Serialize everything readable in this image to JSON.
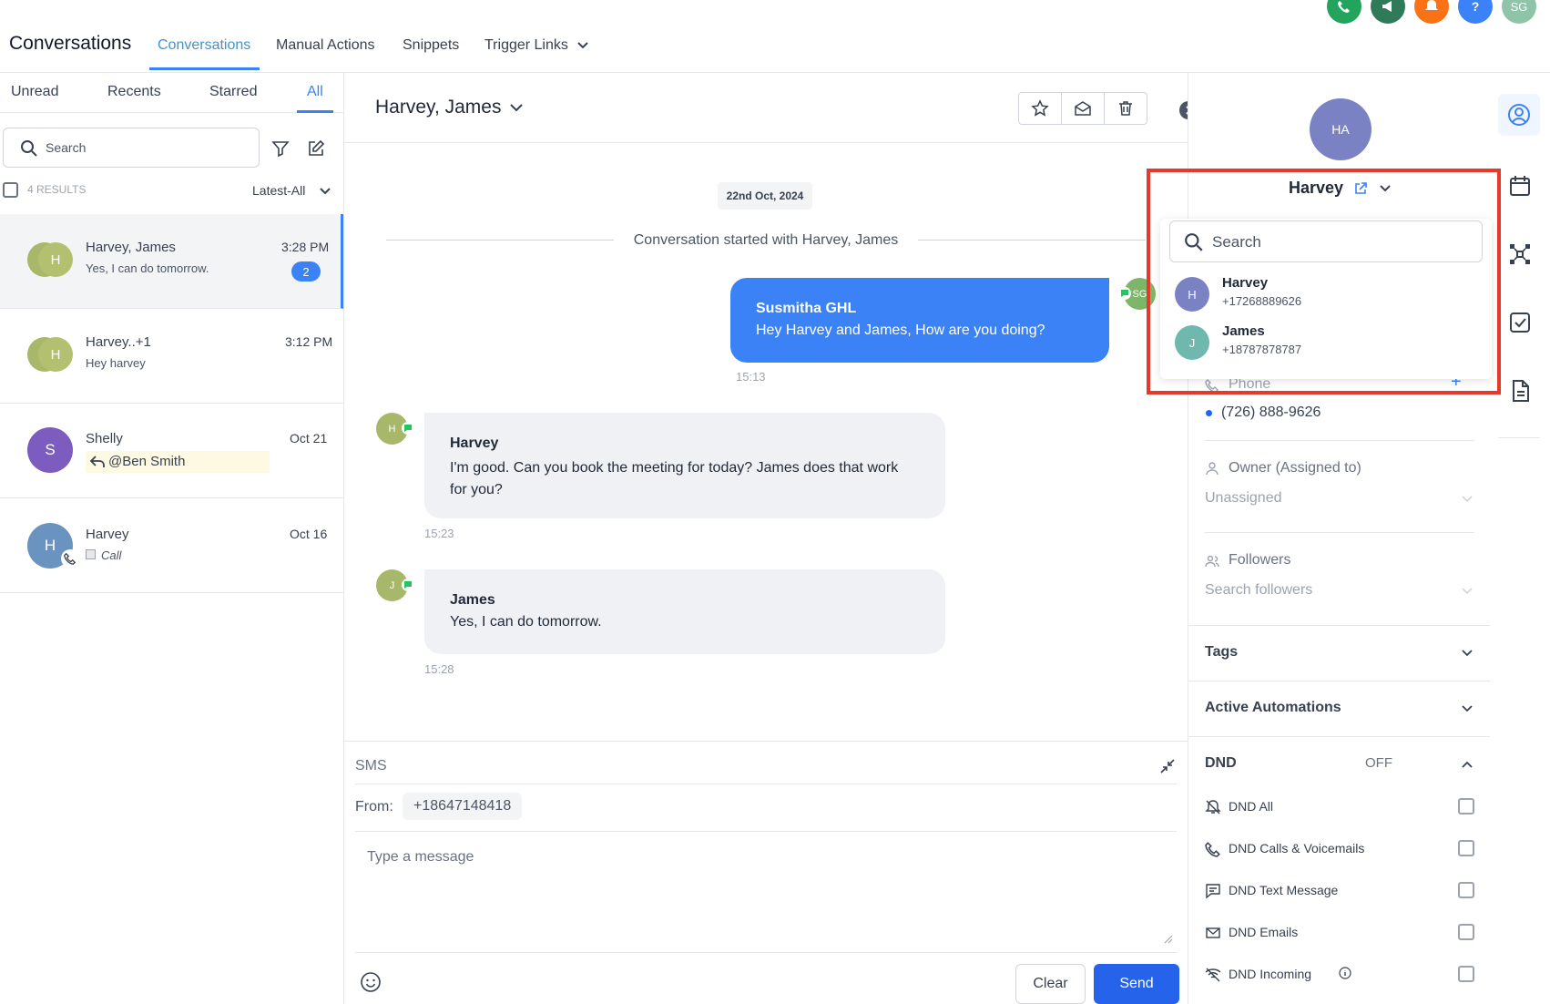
{
  "header": {
    "title": "Conversations",
    "tabs": [
      "Conversations",
      "Manual Actions",
      "Snippets",
      "Trigger Links"
    ],
    "user_initials": "SG"
  },
  "conversation_list": {
    "tabs": [
      "Unread",
      "Recents",
      "Starred",
      "All"
    ],
    "search_placeholder": "Search",
    "results_count": "4 RESULTS",
    "sort": "Latest-All",
    "items": [
      {
        "initial": "H",
        "name": "Harvey, James",
        "preview": "Yes, I can do tomorrow.",
        "time": "3:28 PM",
        "unread": "2"
      },
      {
        "initial": "H",
        "name": "Harvey..+1",
        "preview": "Hey harvey",
        "time": "3:12 PM"
      },
      {
        "initial": "S",
        "name": "Shelly",
        "preview": "@Ben Smith",
        "time": "Oct 21"
      },
      {
        "initial": "H",
        "name": "Harvey",
        "preview": "Call",
        "time": "Oct 16"
      }
    ]
  },
  "chat": {
    "title": "Harvey, James",
    "date": "22nd Oct, 2024",
    "started": "Conversation started with Harvey, James",
    "messages": [
      {
        "sender": "Susmitha GHL",
        "text": "Hey Harvey and James, How are you doing?",
        "time": "15:13",
        "avatar": "SG"
      },
      {
        "sender": "Harvey",
        "text": "I'm good. Can you book the meeting for today? James does that work for you?",
        "time": "15:23",
        "avatar": "H"
      },
      {
        "sender": "James",
        "text": "Yes, I can do tomorrow.",
        "time": "15:28",
        "avatar": "J"
      }
    ]
  },
  "composer": {
    "channel": "SMS",
    "from_label": "From:",
    "from_number": "+18647148418",
    "placeholder": "Type a message",
    "clear_label": "Clear",
    "send_label": "Send"
  },
  "contact": {
    "initials": "HA",
    "name": "Harvey",
    "phone_label": "Phone",
    "phone": "(726) 888-9626",
    "owner_label": "Owner (Assigned to)",
    "owner_value": "Unassigned",
    "followers_label": "Followers",
    "followers_placeholder": "Search followers",
    "tags_label": "Tags",
    "automations_label": "Active Automations",
    "dnd_label": "DND",
    "dnd_status": "OFF",
    "dnd_options": [
      "DND All",
      "DND Calls & Voicemails",
      "DND Text Message",
      "DND Emails",
      "DND Incoming"
    ]
  },
  "contact_dropdown": {
    "search_placeholder": "Search",
    "options": [
      {
        "initial": "H",
        "name": "Harvey",
        "phone": "+17268889626"
      },
      {
        "initial": "J",
        "name": "James",
        "phone": "+18787878787"
      }
    ]
  },
  "colors": {
    "accent": "#3b82f6",
    "highlight": "#e5392b"
  }
}
